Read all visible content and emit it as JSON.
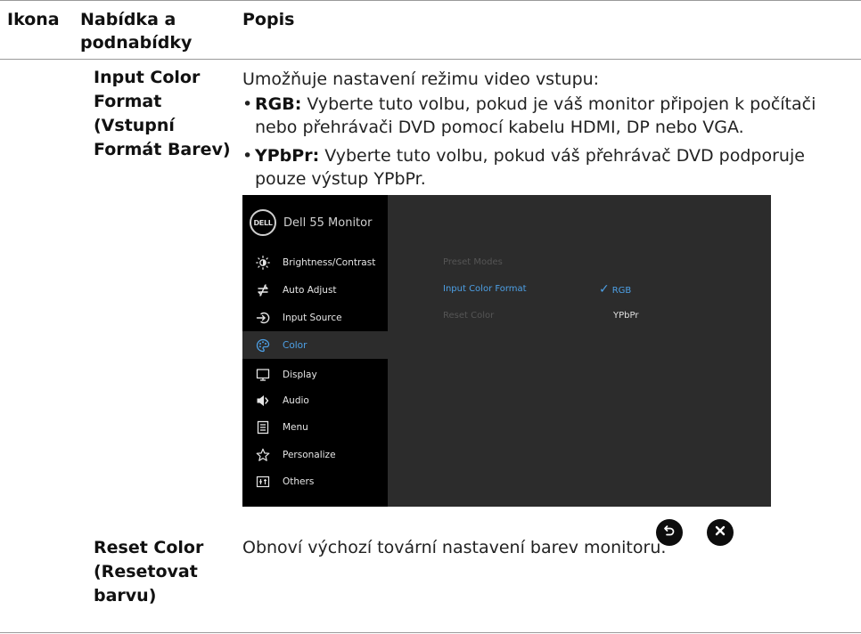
{
  "table": {
    "headers": {
      "icon": "Ikona",
      "menu": "Nabídka a podnabídky",
      "description": "Popis"
    }
  },
  "rows": [
    {
      "menu_name": "Input Color Format (Vstupní Formát Barev)",
      "intro": "Umožňuje nastavení režimu video vstupu:",
      "bullets": [
        {
          "label": "RGB:",
          "text": " Vyberte tuto volbu, pokud je váš monitor připojen k počítači nebo přehrávači DVD pomocí kabelu HDMI, DP nebo VGA."
        },
        {
          "label": "YPbPr:",
          "text": " Vyberte tuto volbu, pokud váš přehrávač DVD podporuje pouze výstup YPbPr."
        }
      ]
    },
    {
      "menu_name": "Reset Color (Resetovat barvu)",
      "description": "Obnoví výchozí tovární nastavení barev monitoru."
    }
  ],
  "osd": {
    "logo_text": "DELL",
    "title": "Dell 55 Monitor",
    "menu": [
      {
        "label": "Brightness/Contrast",
        "icon": "brightness-icon",
        "active": false
      },
      {
        "label": "Auto Adjust",
        "icon": "auto-adjust-icon",
        "active": false
      },
      {
        "label": "Input Source",
        "icon": "input-source-icon",
        "active": false
      },
      {
        "label": "Color",
        "icon": "color-palette-icon",
        "active": true
      },
      {
        "label": "Display",
        "icon": "display-icon",
        "active": false
      },
      {
        "label": "Audio",
        "icon": "speaker-icon",
        "active": false
      },
      {
        "label": "Menu",
        "icon": "menu-icon",
        "active": false
      },
      {
        "label": "Personalize",
        "icon": "star-icon",
        "active": false
      },
      {
        "label": "Others",
        "icon": "others-icon",
        "active": false
      }
    ],
    "options": [
      {
        "label": "Preset Modes",
        "state": "disabled"
      },
      {
        "label": "Input Color Format",
        "state": "selected"
      },
      {
        "label": "Reset Color",
        "state": "disabled"
      }
    ],
    "values": [
      {
        "label": "RGB",
        "checked": true
      },
      {
        "label": "YPbPr",
        "checked": false
      }
    ],
    "check_mark": "✓",
    "accent_color": "#4da0e6"
  },
  "controls": {
    "back_icon": "back-icon",
    "close_icon": "close-icon"
  }
}
